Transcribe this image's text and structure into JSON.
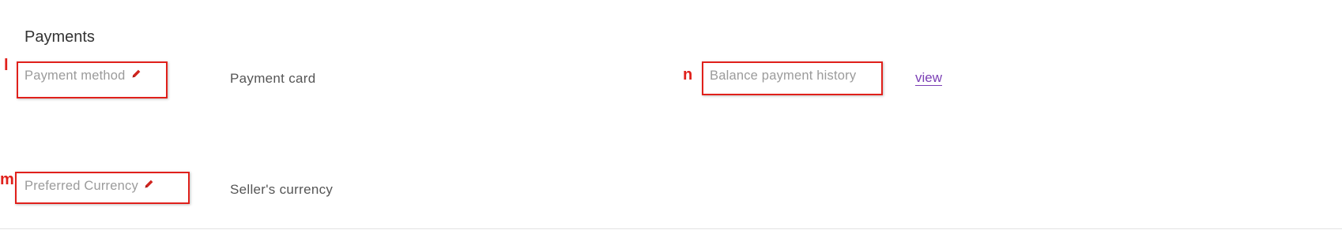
{
  "section": {
    "title": "Payments"
  },
  "fields": {
    "payment_method": {
      "label": "Payment method",
      "value": "Payment card",
      "edit_icon": "pencil-icon"
    },
    "preferred_currency": {
      "label": "Preferred Currency",
      "value": "Seller's currency",
      "edit_icon": "pencil-icon"
    },
    "balance_history": {
      "label": "Balance payment history",
      "link_text": "view"
    }
  },
  "annotations": {
    "l": "l",
    "m": "m",
    "n": "n",
    "color": "#e0201b"
  },
  "colors": {
    "label": "#9b9b9b",
    "value": "#555555",
    "link": "#7b3fb5",
    "edit_icon": "#d0241e"
  }
}
